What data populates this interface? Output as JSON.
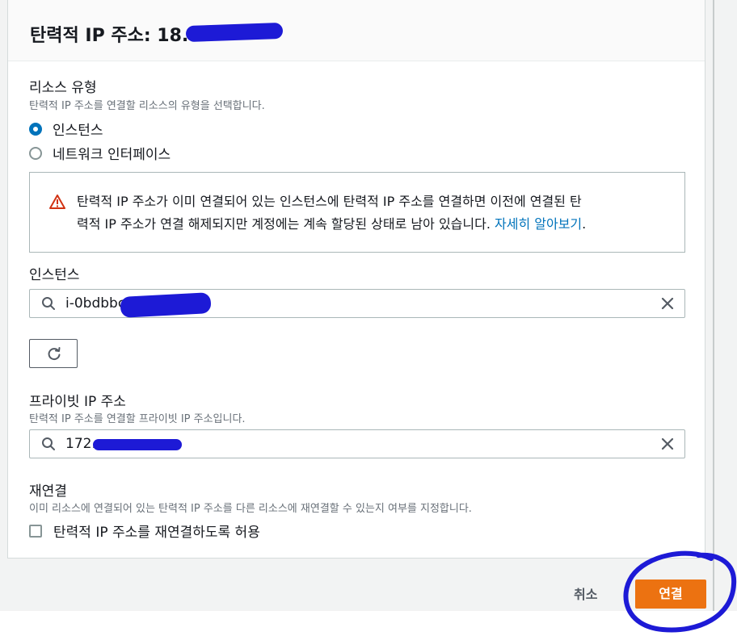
{
  "header": {
    "title": "탄력적 IP 주소: 18."
  },
  "resource_type": {
    "label": "리소스 유형",
    "description": "탄력적 IP 주소를 연결할 리소스의 유형을 선택합니다.",
    "options": [
      {
        "label": "인스턴스",
        "selected": true
      },
      {
        "label": "네트워크 인터페이스",
        "selected": false
      }
    ]
  },
  "alert": {
    "icon": "warning-icon",
    "text_line1": "탄력적 IP 주소가 이미 연결되어 있는 인스턴스에 탄력적 IP 주소를 연결하면 이전에 연결된 탄",
    "text_line2": "력적 IP 주소가 연결 해제되지만 계정에는 계속 할당된 상태로 남아 있습니다.",
    "link": "자세히 알아보기",
    "link_suffix": "."
  },
  "instance": {
    "label": "인스턴스",
    "value": "i-0bdbbc"
  },
  "private_ip": {
    "label": "프라이빗 IP 주소",
    "description": "탄력적 IP 주소를 연결할 프라이빗 IP 주소입니다.",
    "value": "172."
  },
  "reassociation": {
    "label": "재연결",
    "description": "이미 리소스에 연결되어 있는 탄력적 IP 주소를 다른 리소스에 재연결할 수 있는지 여부를 지정합니다.",
    "checkbox_label": "탄력적 IP 주소를 재연결하도록 허용",
    "checked": false
  },
  "footer": {
    "cancel": "취소",
    "associate": "연결"
  },
  "colors": {
    "accent": "#ec7211",
    "link": "#0073bb",
    "warning": "#d13212",
    "redaction": "#1d1ad6"
  }
}
